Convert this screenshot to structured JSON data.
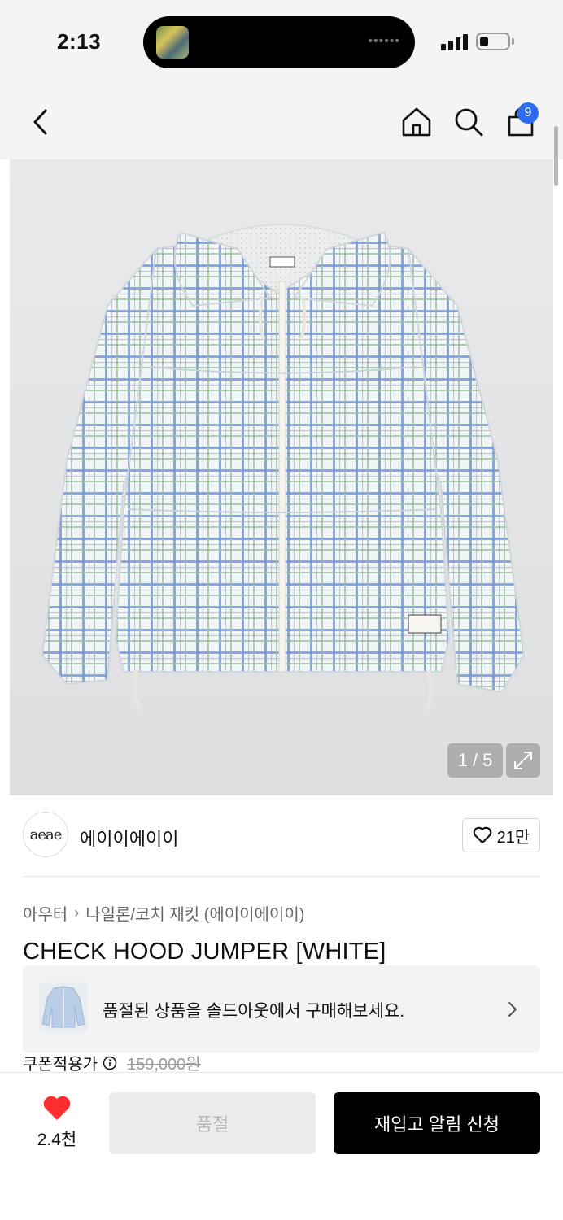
{
  "status_bar": {
    "time": "2:13",
    "island_dots": "••••••"
  },
  "header": {
    "cart_count": "9"
  },
  "gallery": {
    "counter": "1 / 5"
  },
  "brand": {
    "logo_text": "aeae",
    "name": "에이이에이이",
    "like_count": "21만"
  },
  "breadcrumb": {
    "category": "아우터",
    "subcategory": "나일론/코치 재킷 (에이이에이이)"
  },
  "product": {
    "title": "CHECK HOOD JUMPER [WHITE]",
    "price_label": "쿠폰적용가",
    "original_price": "159,000원"
  },
  "banner": {
    "text": "품절된 상품을 솔드아웃에서 구매해보세요."
  },
  "bottom_bar": {
    "wish_count": "2.4천",
    "soldout_label": "품절",
    "restock_label": "재입고 알림 신청"
  },
  "colors": {
    "badge": "#2c6bf3",
    "heart": "#ff2d2d",
    "primary_button": "#000000"
  }
}
